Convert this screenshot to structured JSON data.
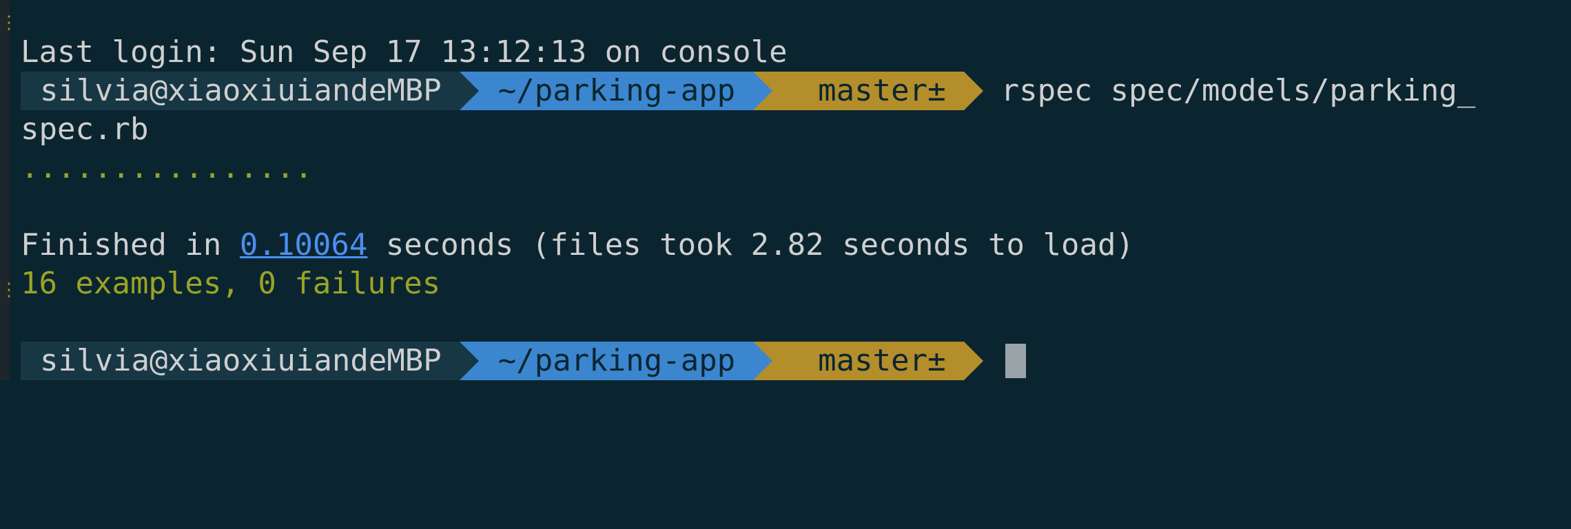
{
  "terminal": {
    "last_login": "Last login: Sun Sep 17 13:12:13 on console",
    "prompt1": {
      "user": "silvia@xiaoxiuiandeMBP",
      "path": "~/parking-app",
      "branch": "master±",
      "command": "rspec spec/models/parking_"
    },
    "wrap_line": "spec.rb",
    "dots": "................",
    "finished_prefix": "Finished in ",
    "finished_time": "0.10064",
    "finished_suffix": " seconds (files took 2.82 seconds to load)",
    "summary": "16 examples, 0 failures",
    "prompt2": {
      "user": "silvia@xiaoxiuiandeMBP",
      "path": "~/parking-app",
      "branch": "master±"
    }
  },
  "colors": {
    "background": "#0b2530",
    "user_segment": "#173745",
    "path_segment": "#3b86cf",
    "git_segment": "#b38e2b",
    "success_text": "#9aa426",
    "link": "#4c8ff0"
  },
  "icons": {
    "branch": "git-branch-icon"
  }
}
